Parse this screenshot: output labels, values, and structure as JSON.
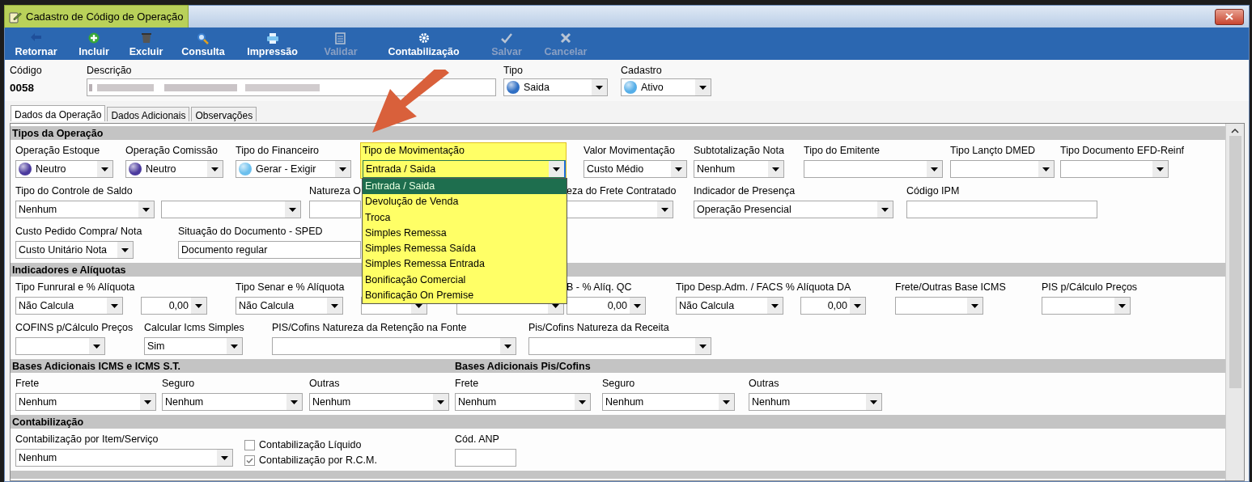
{
  "window": {
    "title": "Cadastro de Código de Operação",
    "highlighted": true
  },
  "toolbar": [
    {
      "label": "Retornar",
      "disabled": false
    },
    {
      "label": "Incluir",
      "disabled": false
    },
    {
      "label": "Excluir",
      "disabled": false
    },
    {
      "label": "Consulta",
      "disabled": false
    },
    {
      "label": "Impressão",
      "disabled": false
    },
    {
      "label": "Validar",
      "disabled": true
    },
    {
      "label": "Contabilização",
      "disabled": false
    },
    {
      "label": "Salvar",
      "disabled": true
    },
    {
      "label": "Cancelar",
      "disabled": true
    }
  ],
  "header": {
    "codigo": {
      "label": "Código",
      "value": "0058"
    },
    "descricao": {
      "label": "Descrição"
    },
    "tipo": {
      "label": "Tipo",
      "value": "Saida",
      "color": "#2f6fc4"
    },
    "cadastro": {
      "label": "Cadastro",
      "value": "Ativo",
      "color": "#55aee8"
    }
  },
  "tabs": [
    {
      "label": "Dados da Operação",
      "selected": true
    },
    {
      "label": "Dados Adicionais",
      "selected": false
    },
    {
      "label": "Observações",
      "selected": false
    }
  ],
  "sections": [
    {
      "titles": [
        "Tipos da Operação"
      ],
      "field_lines": [
        [
          {
            "kind": "combo",
            "label": "Operação Estoque",
            "value": "Neutro",
            "color": "#4b3a9e"
          },
          {
            "kind": "combo",
            "label": "Operação Comissão",
            "value": "Neutro",
            "color": "#4b3a9e"
          },
          {
            "kind": "combo",
            "label": "Tipo do Financeiro",
            "value": "Gerar - Exigir",
            "color": "#6cc0ee"
          },
          {
            "kind": "combo",
            "label": "Tipo de Movimentação",
            "value": "Entrada / Saida",
            "highlighted": true,
            "options": [
              {
                "label": "Entrada / Saida",
                "selected": true
              },
              {
                "label": "Devolução de Venda",
                "selected": false
              },
              {
                "label": "Troca",
                "selected": false
              },
              {
                "label": "Simples Remessa",
                "selected": false
              },
              {
                "label": "Simples Remessa Saída",
                "selected": false
              },
              {
                "label": "Simples Remessa Entrada",
                "selected": false
              },
              {
                "label": "Bonificação Comercial",
                "selected": false
              },
              {
                "label": "Bonificação On Premise",
                "selected": false
              }
            ]
          },
          {
            "kind": "combo",
            "label": "Valor Movimentação",
            "value": "Custo Médio"
          },
          {
            "kind": "combo",
            "label": "Subtotalização Nota",
            "value": "Nenhum"
          },
          {
            "kind": "combo",
            "label": "Tipo do Emitente"
          },
          {
            "kind": "combo",
            "label": "Tipo Lançto DMED"
          },
          {
            "kind": "combo",
            "label": "Tipo Documento EFD-Reinf"
          }
        ],
        [
          {
            "kind": "combo",
            "label": "Tipo do Controle de Saldo",
            "value": "Nenhum"
          },
          {
            "kind": "combo"
          },
          {
            "kind": "combo",
            "label": "Natureza O"
          },
          {
            "kind": "combo",
            "label": "eza do Frete Contratado"
          },
          {
            "kind": "combo",
            "label": "Indicador de Presença",
            "value": "Operação Presencial"
          },
          {
            "kind": "text",
            "label": "Código IPM"
          }
        ],
        [
          {
            "kind": "combo",
            "label": "Custo Pedido Compra/ Nota",
            "value": "Custo Unitário Nota"
          },
          {
            "kind": "combo",
            "label": "Situação do Documento - SPED",
            "value": "Documento regular"
          }
        ]
      ]
    },
    {
      "titles": [
        "Indicadores e Alíquotas"
      ],
      "field_lines": [
        [
          {
            "kind": "combo",
            "label": "Tipo Funrural e % Alíquota",
            "value": "Não Calcula"
          },
          {
            "kind": "numeric",
            "value": "0,00"
          },
          {
            "kind": "combo",
            "label": "Tipo Senar e % Alíquota",
            "value": "Não Calcula"
          },
          {
            "kind": "numeric"
          },
          {
            "kind": "combo"
          },
          {
            "kind": "numeric",
            "label": "B - % Alíq. QC",
            "value": "0,00"
          },
          {
            "kind": "combo",
            "label": "Tipo Desp.Adm. / FACS % Alíquota DA",
            "value": "Não Calcula"
          },
          {
            "kind": "numeric",
            "value": "0,00"
          },
          {
            "kind": "combo",
            "label": "Frete/Outras Base ICMS"
          },
          {
            "kind": "combo",
            "label": "PIS p/Cálculo Preços"
          }
        ],
        [
          {
            "kind": "combo",
            "label": "COFINS p/Cálculo Preços"
          },
          {
            "kind": "combo",
            "label": "Calcular Icms Simples",
            "value": "Sim"
          },
          {
            "kind": "combo",
            "label": "PIS/Cofins Natureza da Retenção na Fonte"
          },
          {
            "kind": "combo",
            "label": "Pis/Cofins Natureza da Receita"
          }
        ]
      ]
    },
    {
      "titles": [
        "Bases Adicionais ICMS e ICMS S.T.",
        "Bases Adicionais Pis/Cofins"
      ],
      "field_lines": [
        [
          {
            "kind": "combo",
            "label": "Frete",
            "value": "Nenhum"
          },
          {
            "kind": "combo",
            "label": "Seguro",
            "value": "Nenhum"
          },
          {
            "kind": "combo",
            "label": "Outras",
            "value": "Nenhum"
          },
          {
            "kind": "combo",
            "label": "Frete",
            "value": "Nenhum"
          },
          {
            "kind": "combo",
            "label": "Seguro",
            "value": "Nenhum"
          },
          {
            "kind": "combo",
            "label": "Outras",
            "value": "Nenhum"
          }
        ]
      ]
    },
    {
      "titles": [
        "Contabilização"
      ],
      "field_lines": [
        [
          {
            "kind": "combo",
            "label": "Contabilização por Item/Serviço",
            "value": "Nenhum"
          },
          {
            "kind": "checks",
            "items": [
              {
                "label": "Contabilização Líquido",
                "checked": false
              },
              {
                "label": "Contabilização por R.C.M.",
                "checked": true
              }
            ]
          },
          {
            "kind": "text",
            "label": "Cód. ANP"
          }
        ]
      ]
    }
  ]
}
